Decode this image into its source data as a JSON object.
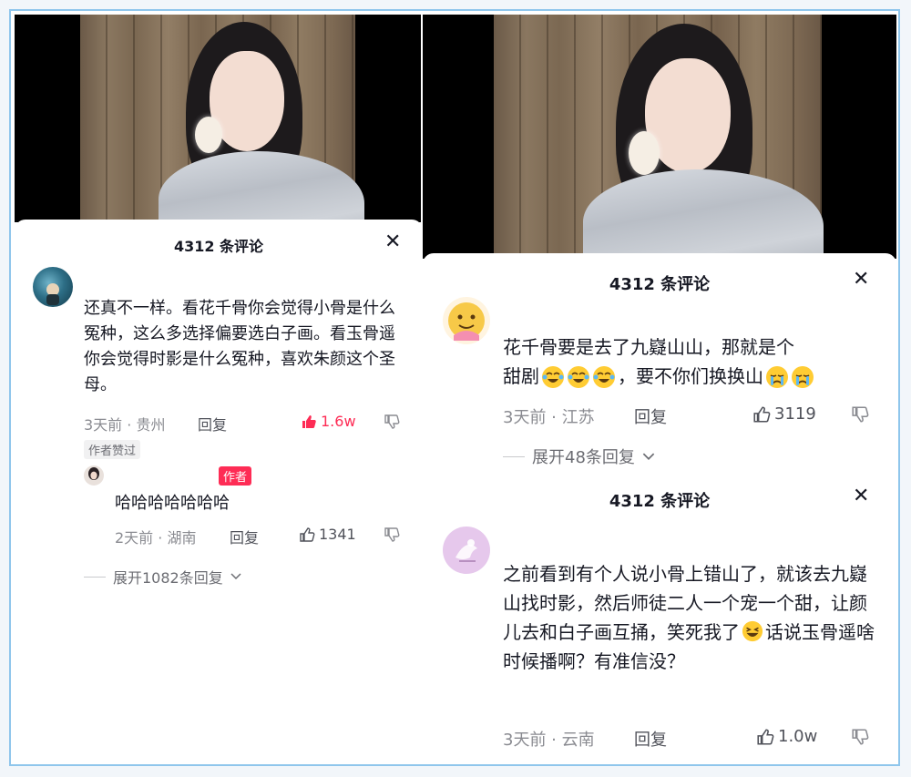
{
  "panel_left": {
    "title": "4312 条评论",
    "comment": {
      "text": "还真不一样。看花千骨你会觉得小骨是什么冤种，这么多选择偏要选白子画。看玉骨遥你会觉得时影是什么冤种，喜欢朱颜这个圣母。",
      "meta": "3天前 · 贵州",
      "reply_label": "回复",
      "likes": "1.6w",
      "badge": "作者赞过"
    },
    "reply": {
      "author_tag": "作者",
      "text": "哈哈哈哈哈哈哈",
      "meta": "2天前 · 湖南",
      "reply_label": "回复",
      "likes": "1341"
    },
    "expand": "展开1082条回复"
  },
  "panel_right_top": {
    "title": "4312 条评论",
    "comment": {
      "text_line1": "花千骨要是去了九嶷山山，那就是个",
      "text_line2_a": "甜剧",
      "text_line2_b": "，要不你们换换山",
      "meta": "3天前 · 江苏",
      "reply_label": "回复",
      "likes": "3119"
    },
    "expand": "展开48条回复"
  },
  "panel_right_bottom": {
    "title": "4312 条评论",
    "comment": {
      "text_a": "之前看到有个人说小骨上错山了，就该去九嶷山找时影，然后师徒二人一个宠一个甜，让颜儿去和白子画互捅，笑死我了",
      "text_b": "话说玉骨遥啥时候播啊？有准信没？",
      "meta": "3天前 · 云南",
      "reply_label": "回复",
      "likes": "1.0w"
    }
  },
  "colors": {
    "accent": "#fe2c55",
    "text": "#161823",
    "muted": "#8a8b91",
    "border": "#8fc6ec"
  },
  "icons": [
    "close-icon",
    "thumbs-up-icon",
    "thumbs-down-icon",
    "chevron-down-icon",
    "emoji-laugh-cry-icon",
    "emoji-cry-icon",
    "emoji-grin-icon"
  ]
}
